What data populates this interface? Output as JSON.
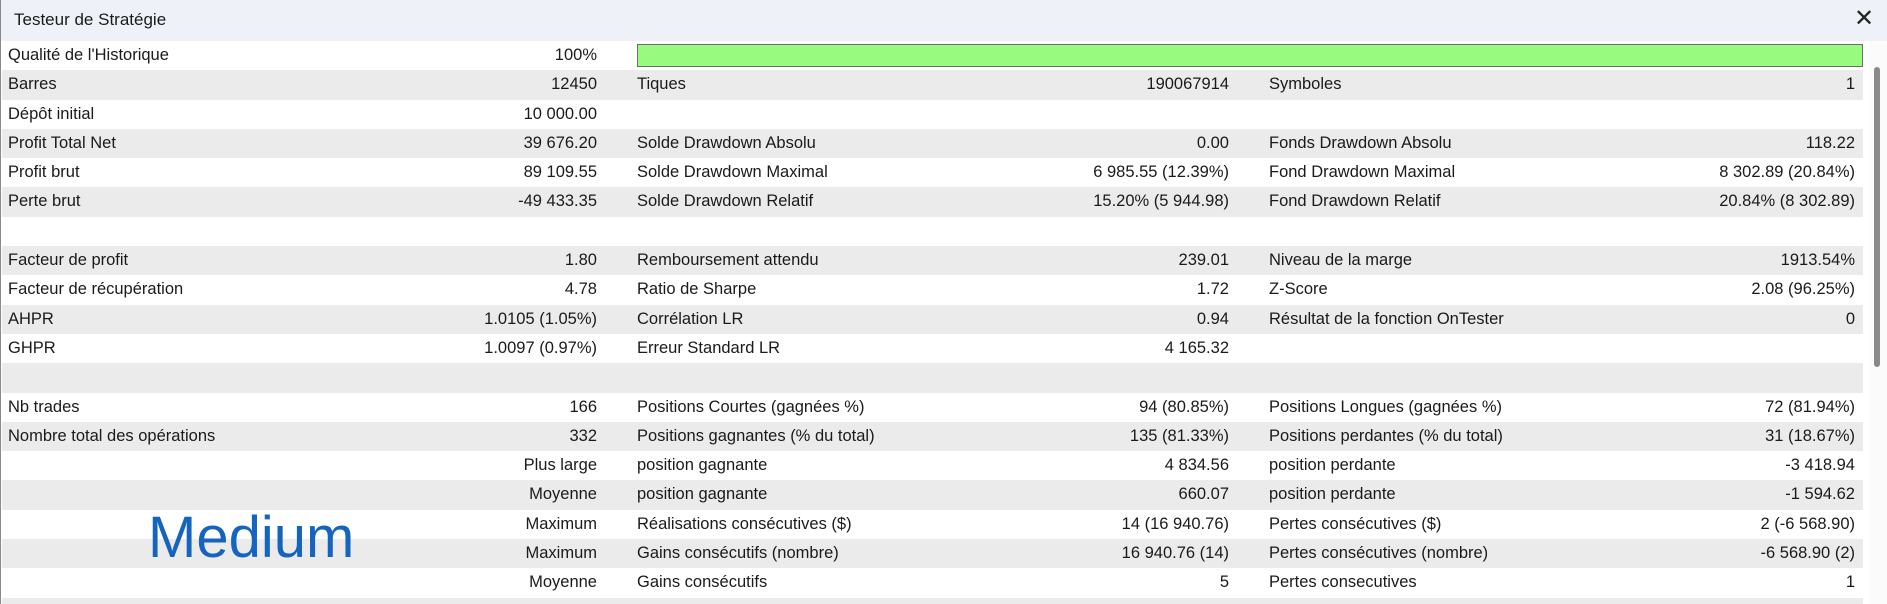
{
  "window": {
    "title": "Testeur de Stratégie",
    "close_icon": "close-icon"
  },
  "watermark": "Medium",
  "history_quality": {
    "label": "Qualité de l'Historique",
    "value": "100%",
    "percent": 100,
    "bar_color": "#98fb80"
  },
  "rows": [
    {
      "l1": "Barres",
      "v1": "12450",
      "l2": "Tiques",
      "v2": "190067914",
      "l3": "Symboles",
      "v3": "1"
    },
    {
      "l1": "Dépôt initial",
      "v1": "10 000.00",
      "l2": "",
      "v2": "",
      "l3": "",
      "v3": ""
    },
    {
      "l1": "Profit Total Net",
      "v1": "39 676.20",
      "l2": "Solde Drawdown Absolu",
      "v2": "0.00",
      "l3": "Fonds Drawdown Absolu",
      "v3": "118.22"
    },
    {
      "l1": "Profit brut",
      "v1": "89 109.55",
      "l2": "Solde Drawdown Maximal",
      "v2": "6 985.55 (12.39%)",
      "l3": "Fond Drawdown Maximal",
      "v3": "8 302.89 (20.84%)"
    },
    {
      "l1": "Perte brut",
      "v1": "-49 433.35",
      "l2": "Solde Drawdown Relatif",
      "v2": "15.20% (5 944.98)",
      "l3": "Fond Drawdown Relatif",
      "v3": "20.84% (8 302.89)"
    },
    {
      "l1": "",
      "v1": "",
      "l2": "",
      "v2": "",
      "l3": "",
      "v3": ""
    },
    {
      "l1": "Facteur de profit",
      "v1": "1.80",
      "l2": "Remboursement attendu",
      "v2": "239.01",
      "l3": "Niveau de la marge",
      "v3": "1913.54%"
    },
    {
      "l1": "Facteur de récupération",
      "v1": "4.78",
      "l2": "Ratio de Sharpe",
      "v2": "1.72",
      "l3": "Z-Score",
      "v3": "2.08 (96.25%)"
    },
    {
      "l1": "AHPR",
      "v1": "1.0105 (1.05%)",
      "l2": "Corrélation LR",
      "v2": "0.94",
      "l3": "Résultat de la fonction OnTester",
      "v3": "0"
    },
    {
      "l1": "GHPR",
      "v1": "1.0097 (0.97%)",
      "l2": "Erreur Standard LR",
      "v2": "4 165.32",
      "l3": "",
      "v3": ""
    },
    {
      "l1": "",
      "v1": "",
      "l2": "",
      "v2": "",
      "l3": "",
      "v3": ""
    },
    {
      "l1": "Nb trades",
      "v1": "166",
      "l2": "Positions Courtes (gagnées %)",
      "v2": "94 (80.85%)",
      "l3": "Positions Longues (gagnées %)",
      "v3": "72 (81.94%)"
    },
    {
      "l1": "Nombre total des opérations",
      "v1": "332",
      "l2": "Positions gagnantes (% du total)",
      "v2": "135 (81.33%)",
      "l3": "Positions perdantes (% du total)",
      "v3": "31 (18.67%)"
    },
    {
      "l1": "",
      "v1": "Plus large",
      "l2": "position gagnante",
      "v2": "4 834.56",
      "l3": "position perdante",
      "v3": "-3 418.94"
    },
    {
      "l1": "",
      "v1": "Moyenne",
      "l2": "position gagnante",
      "v2": "660.07",
      "l3": "position perdante",
      "v3": "-1 594.62"
    },
    {
      "l1": "",
      "v1": "Maximum",
      "l2": "Réalisations consécutives ($)",
      "v2": "14 (16 940.76)",
      "l3": "Pertes consécutives ($)",
      "v3": "2 (-6 568.90)"
    },
    {
      "l1": "",
      "v1": "Maximum",
      "l2": "Gains consécutifs (nombre)",
      "v2": "16 940.76 (14)",
      "l3": "Pertes consécutives (nombre)",
      "v3": "-6 568.90 (2)"
    },
    {
      "l1": "",
      "v1": "Moyenne",
      "l2": "Gains consécutifs",
      "v2": "5",
      "l3": "Pertes consecutives",
      "v3": "1"
    },
    {
      "l1": "",
      "v1": "",
      "l2": "",
      "v2": "",
      "l3": "",
      "v3": ""
    }
  ]
}
